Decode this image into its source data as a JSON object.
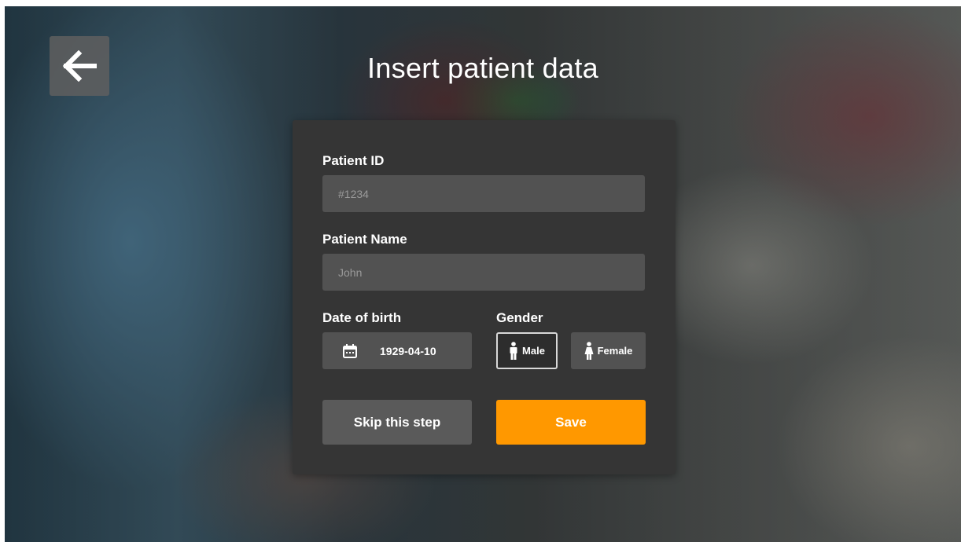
{
  "header": {
    "title": "Insert patient data",
    "back_icon": "arrow-left-icon"
  },
  "form": {
    "patient_id": {
      "label": "Patient ID",
      "placeholder": "#1234",
      "value": ""
    },
    "patient_name": {
      "label": "Patient Name",
      "placeholder": "John",
      "value": ""
    },
    "date_of_birth": {
      "label": "Date of birth",
      "value": "1929-04-10",
      "icon": "calendar-icon"
    },
    "gender": {
      "label": "Gender",
      "selected": "Male",
      "options": [
        {
          "label": "Male",
          "icon": "male-icon"
        },
        {
          "label": "Female",
          "icon": "female-icon"
        }
      ]
    }
  },
  "actions": {
    "skip_label": "Skip this step",
    "save_label": "Save"
  },
  "colors": {
    "accent": "#FF9800",
    "card": "#353535",
    "field": "#525252",
    "secondary_button": "#5a5a5a"
  }
}
